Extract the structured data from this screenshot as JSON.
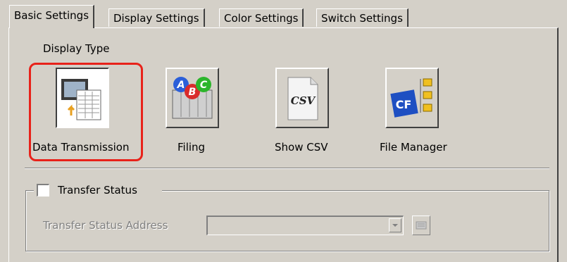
{
  "tabs": [
    {
      "label": "Basic Settings",
      "active": true
    },
    {
      "label": "Display Settings",
      "active": false
    },
    {
      "label": "Color Settings",
      "active": false
    },
    {
      "label": "Switch Settings",
      "active": false
    }
  ],
  "display_type": {
    "heading": "Display Type",
    "options": [
      {
        "label": "Data Transmission",
        "icon": "data-transmission-icon",
        "selected": true
      },
      {
        "label": "Filing",
        "icon": "filing-icon",
        "selected": false
      },
      {
        "label": "Show CSV",
        "icon": "csv-file-icon",
        "selected": false
      },
      {
        "label": "File Manager",
        "icon": "file-manager-icon",
        "selected": false
      }
    ],
    "csv_icon_text": "CSV",
    "filing_letters": [
      "A",
      "B",
      "C"
    ],
    "cf_icon_text": "CF"
  },
  "transfer_status": {
    "checkbox_label": "Transfer Status",
    "checked": false,
    "address_label": "Transfer Status Address",
    "address_value": ""
  },
  "colors": {
    "highlight": "#e8221a",
    "face": "#d4d0c8"
  }
}
